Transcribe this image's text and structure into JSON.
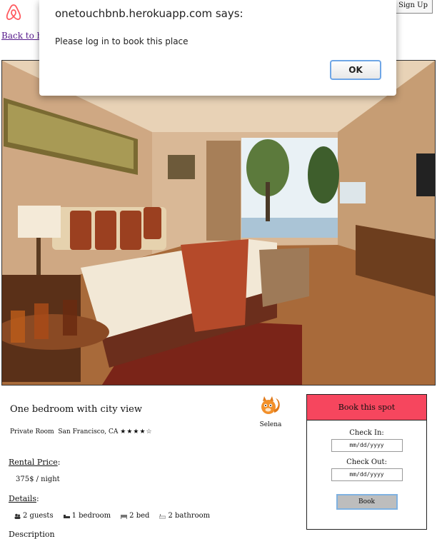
{
  "dialog": {
    "title": "onetouchbnb.herokuapp.com says:",
    "message": "Please log in to book this place",
    "ok_label": "OK"
  },
  "nav": {
    "logo_icon": "airbnb-logo-icon",
    "signup_label": "Sign Up",
    "back_link": "Back to home"
  },
  "listing": {
    "title": "One bedroom with city view",
    "room_type": "Private Room",
    "city": "San Francisco, CA",
    "stars": "★★★★☆",
    "rating": 4,
    "host_name": "Selena",
    "rental_price_label": "Rental Price",
    "price": "375$ / night",
    "details_label": "Details",
    "details": [
      {
        "icon": "guests-icon",
        "text": "2 guests"
      },
      {
        "icon": "bedroom-icon",
        "text": "1 bedroom"
      },
      {
        "icon": "bed-icon",
        "text": "2 bed"
      },
      {
        "icon": "bathroom-icon",
        "text": "2 bathroom"
      }
    ],
    "description_label": "Description"
  },
  "booking": {
    "header": "Book this spot",
    "check_in_label": "Check In:",
    "check_in_placeholder": "mm/dd/yyyy",
    "check_out_label": "Check Out:",
    "check_out_placeholder": "mm/dd/yyyy",
    "book_label": "Book"
  },
  "colors": {
    "brand": "#ff5a5f",
    "book_header": "#f6465e",
    "link": "#551a8b",
    "button_focus": "#7fb1e0"
  }
}
